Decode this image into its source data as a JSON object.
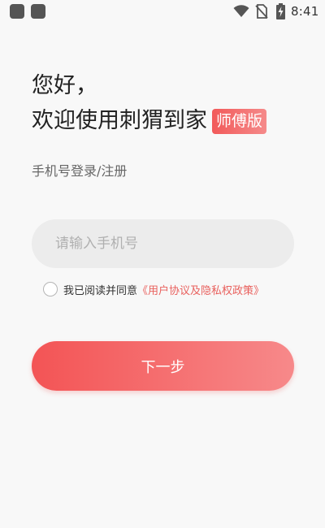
{
  "status_bar": {
    "time": "8:41",
    "icons": [
      "app-notification-icon",
      "app-notification-icon",
      "wifi-icon",
      "no-sim-icon",
      "battery-charging-icon"
    ]
  },
  "header": {
    "greeting": "您好，",
    "welcome": "欢迎使用刺猬到家",
    "badge": "师傅版"
  },
  "subtitle": "手机号登录/注册",
  "phone_input": {
    "value": "",
    "placeholder": "请输入手机号"
  },
  "agreement": {
    "checked": false,
    "text": "我已阅读并同意",
    "link": "《用户协议及隐私权政策》"
  },
  "next_button": {
    "label": "下一步"
  },
  "colors": {
    "accent": "#f35455",
    "accent_light": "#f7898a",
    "background": "#f8f8f8",
    "input_bg": "#ececec"
  }
}
